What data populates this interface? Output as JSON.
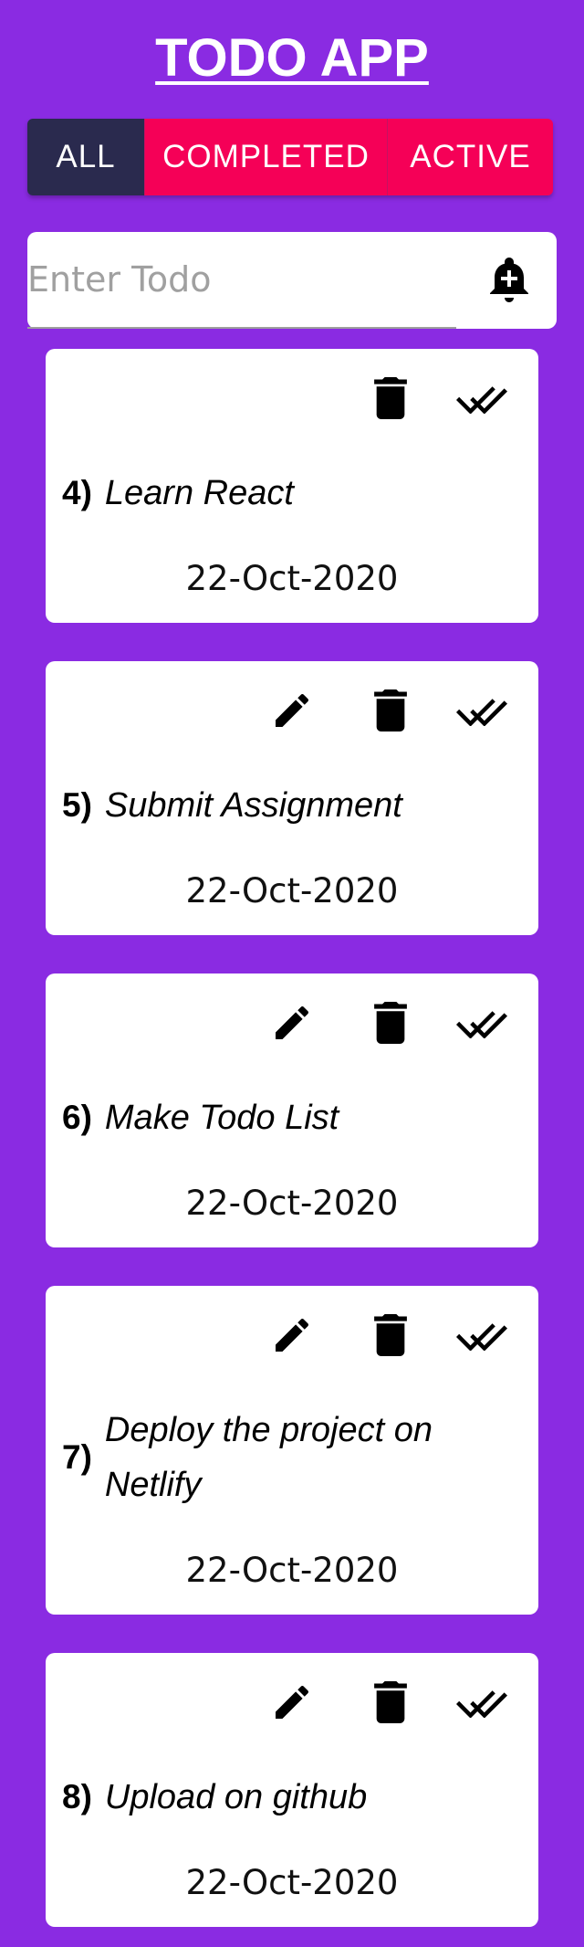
{
  "app": {
    "title": "TODO APP"
  },
  "filters": {
    "all_label": "ALL",
    "completed_label": "COMPLETED",
    "active_label": "ACTIVE",
    "selected": "ALL"
  },
  "input": {
    "placeholder": "Enter Todo",
    "value": "",
    "add_icon": "add-alert-bell-icon"
  },
  "icons": {
    "edit": "pencil-icon",
    "delete": "trash-icon",
    "complete": "double-check-icon"
  },
  "colors": {
    "background": "#8a2be2",
    "filter_selected": "#2a2a4e",
    "filter_unselected": "#f50057",
    "card": "#ffffff"
  },
  "todos": [
    {
      "number": "4)",
      "text": "Learn React",
      "date": "22-Oct-2020",
      "editable": false
    },
    {
      "number": "5)",
      "text": "Submit Assignment",
      "date": "22-Oct-2020",
      "editable": true
    },
    {
      "number": "6)",
      "text": "Make Todo List",
      "date": "22-Oct-2020",
      "editable": true
    },
    {
      "number": "7)",
      "text": "Deploy the project on Netlify",
      "date": "22-Oct-2020",
      "editable": true
    },
    {
      "number": "8)",
      "text": "Upload on github",
      "date": "22-Oct-2020",
      "editable": true
    }
  ]
}
